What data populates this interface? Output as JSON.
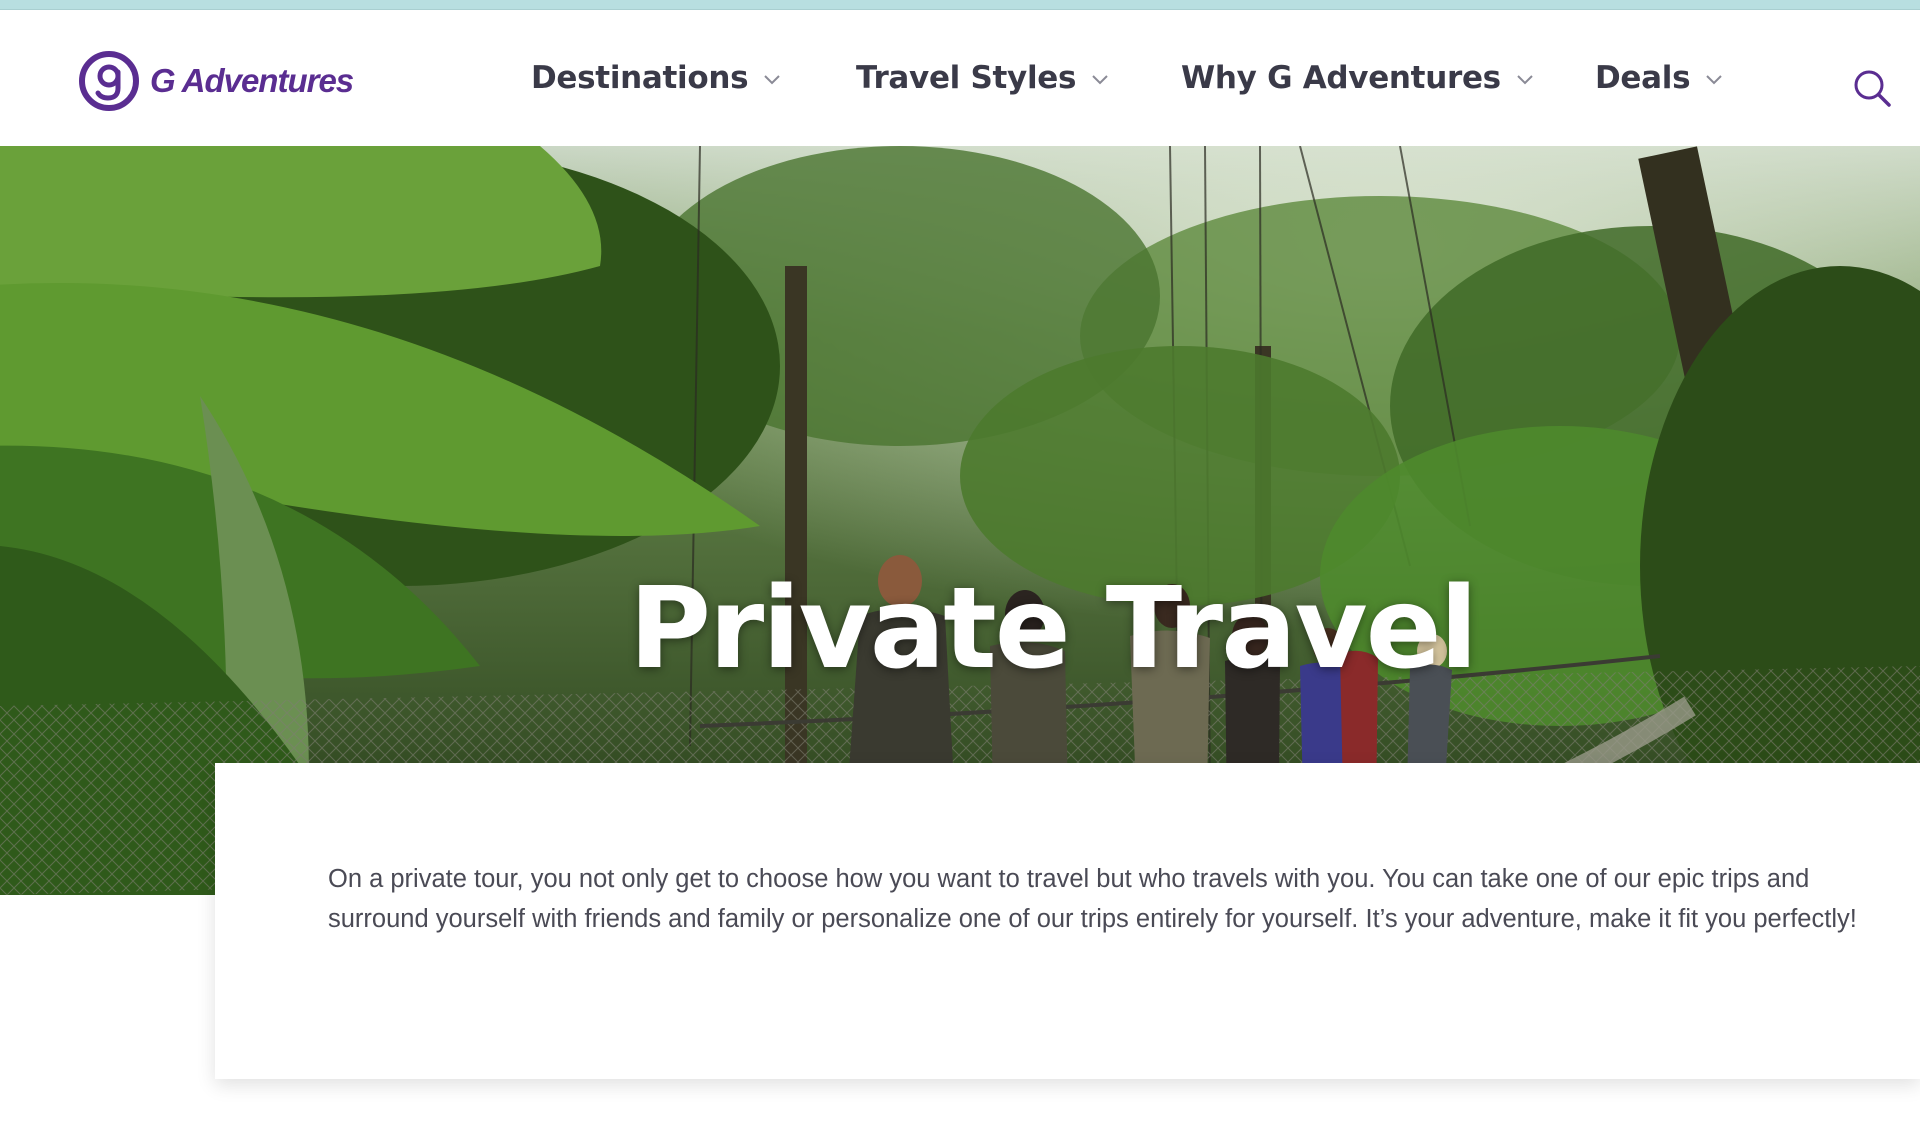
{
  "brand": {
    "name": "G Adventures",
    "color": "#5a2d91"
  },
  "nav": {
    "items": [
      {
        "label": "Destinations"
      },
      {
        "label": "Travel Styles"
      },
      {
        "label": "Why G Adventures"
      },
      {
        "label": "Deals"
      }
    ],
    "search_icon": "search-icon",
    "dropdown_icon": "chevron-down-icon"
  },
  "hero": {
    "title": "Private Travel"
  },
  "intro": {
    "text": "On a private tour, you not only get to choose how you want to travel but who travels with you. You can take one of our epic trips and surround yourself with friends and family or personalize one of our trips entirely for yourself. It’s your adventure, make it fit you perfectly!"
  },
  "colors": {
    "accent": "#5a2d91",
    "nav_text": "#3a3a48",
    "body_text": "#4a4a55",
    "top_strip": "#b8dfe0"
  }
}
